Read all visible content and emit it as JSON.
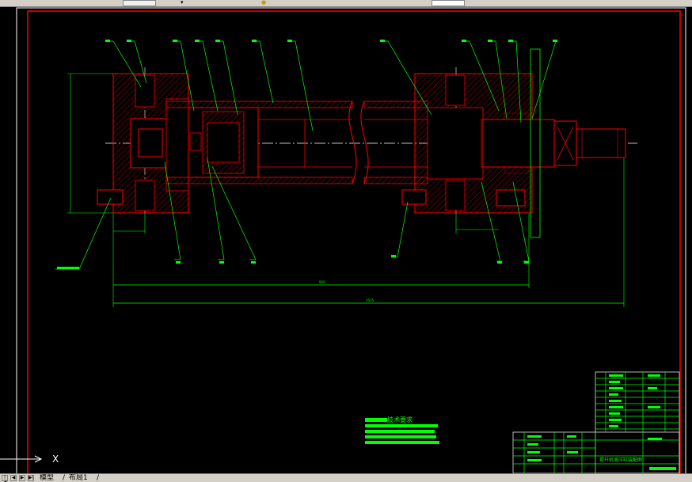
{
  "toolbar": {
    "dropdown_arrow": "▾",
    "status_icon": "●"
  },
  "annotations": {
    "tech_requirements_title": "技术要求",
    "title_block_name": "提升机液压缸装配图",
    "dim_overall": "1035",
    "dim_inner": "920"
  },
  "ucs": {
    "x_label": "X"
  },
  "tabs": {
    "model": "模型",
    "layout1": "布局1"
  },
  "colors": {
    "background": "#000000",
    "border": "#ff0000",
    "geometry": "#ff0000",
    "leaders": "#00ff00",
    "centerline": "#ffffff",
    "frame": "#ffffff",
    "hatch": "#ff0000"
  }
}
